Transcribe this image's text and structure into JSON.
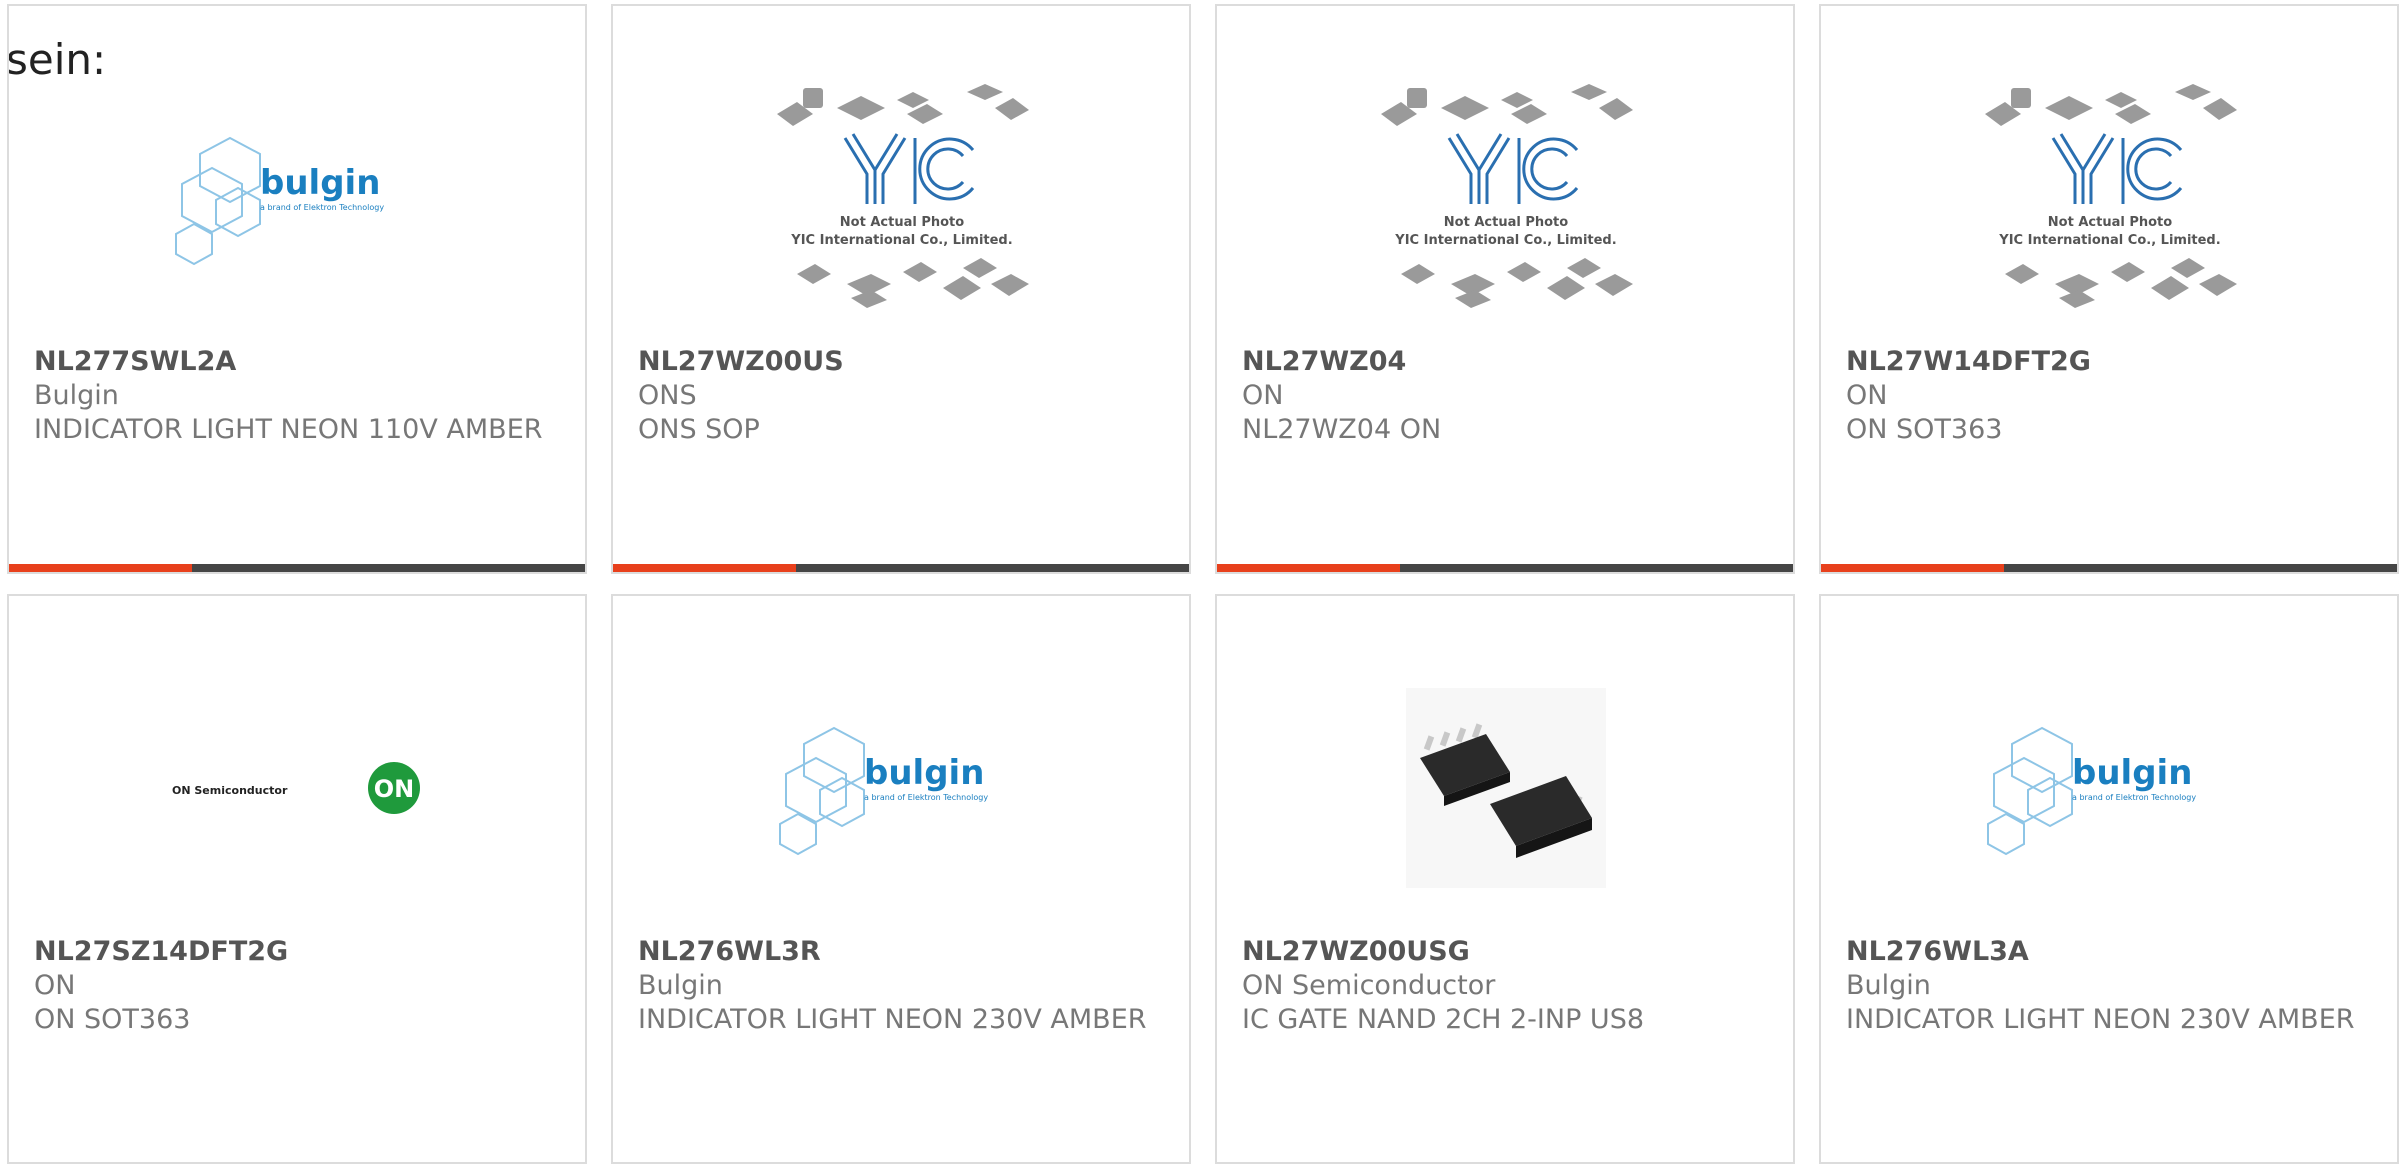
{
  "page": {
    "heading": "sein:"
  },
  "colors": {
    "accent": "#e8401c",
    "bar": "#454545",
    "bulgin_blue": "#1a7fc0",
    "on_green": "#1f9a3c"
  },
  "products": [
    {
      "part_number": "NL277SWL2A",
      "manufacturer": "Bulgin",
      "description": "INDICATOR LIGHT NEON 110V AMBER",
      "image": "bulgin-logo",
      "logo_text": "bulgin",
      "logo_tagline": "a brand of Elektron Technology",
      "accent_bar": true
    },
    {
      "part_number": "NL27WZ00US",
      "manufacturer": "ONS",
      "description": "ONS SOP",
      "image": "yic-placeholder",
      "logo_text": "YIC",
      "caption_line1": "Not Actual Photo",
      "caption_line2": "YIC International Co., Limited.",
      "accent_bar": true
    },
    {
      "part_number": "NL27WZ04",
      "manufacturer": "ON",
      "description": "NL27WZ04 ON",
      "image": "yic-placeholder",
      "logo_text": "YIC",
      "caption_line1": "Not Actual Photo",
      "caption_line2": "YIC International Co., Limited.",
      "accent_bar": true
    },
    {
      "part_number": "NL27W14DFT2G",
      "manufacturer": "ON",
      "description": "ON SOT363",
      "image": "yic-placeholder",
      "logo_text": "YIC",
      "caption_line1": "Not Actual Photo",
      "caption_line2": "YIC International Co., Limited.",
      "accent_bar": true
    },
    {
      "part_number": "NL27SZ14DFT2G",
      "manufacturer": "ON",
      "description": "ON SOT363",
      "image": "on-semiconductor-logo",
      "logo_text": "ON Semiconductor",
      "logo_mark": "ON",
      "accent_bar": false
    },
    {
      "part_number": "NL276WL3R",
      "manufacturer": "Bulgin",
      "description": "INDICATOR LIGHT NEON 230V AMBER",
      "image": "bulgin-logo",
      "logo_text": "bulgin",
      "logo_tagline": "a brand of Elektron Technology",
      "accent_bar": false
    },
    {
      "part_number": "NL27WZ00USG",
      "manufacturer": "ON Semiconductor",
      "description": "IC GATE NAND 2CH 2-INP US8",
      "image": "chip-photo",
      "accent_bar": false
    },
    {
      "part_number": "NL276WL3A",
      "manufacturer": "Bulgin",
      "description": "INDICATOR LIGHT NEON 230V AMBER",
      "image": "bulgin-logo",
      "logo_text": "bulgin",
      "logo_tagline": "a brand of Elektron Technology",
      "accent_bar": false
    }
  ]
}
